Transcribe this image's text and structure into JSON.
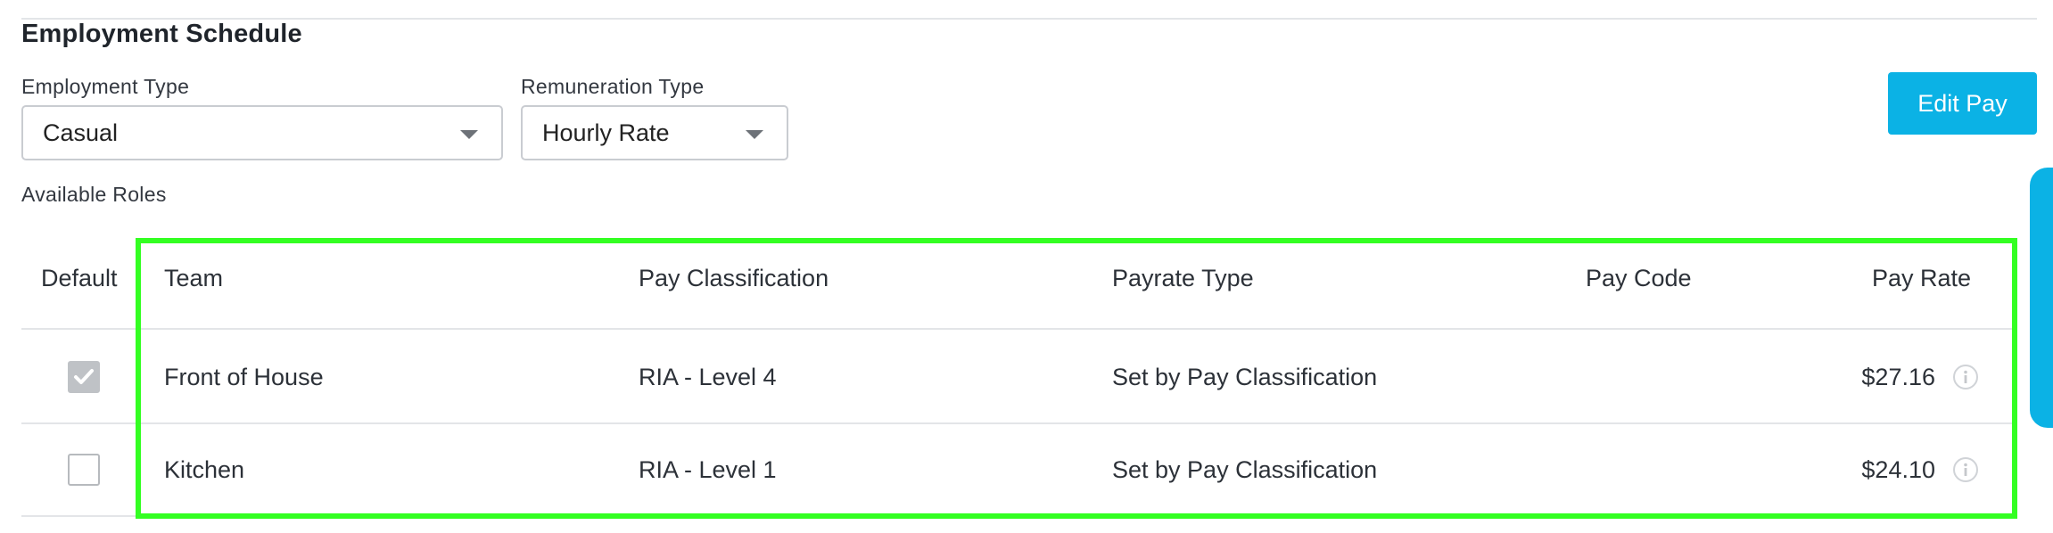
{
  "section": {
    "title": "Employment Schedule"
  },
  "filters": {
    "employment_type": {
      "label": "Employment Type",
      "value": "Casual"
    },
    "remuneration_type": {
      "label": "Remuneration Type",
      "value": "Hourly Rate"
    }
  },
  "actions": {
    "edit_pay_label": "Edit Pay"
  },
  "roles": {
    "label": "Available Roles",
    "columns": [
      "Default",
      "Team",
      "Pay Classification",
      "Payrate Type",
      "Pay Code",
      "Pay Rate"
    ],
    "rows": [
      {
        "default": true,
        "team": "Front of House",
        "pay_classification": "RIA - Level 4",
        "payrate_type": "Set by Pay Classification",
        "pay_code": "",
        "pay_rate": "$27.16"
      },
      {
        "default": false,
        "team": "Kitchen",
        "pay_classification": "RIA - Level 1",
        "payrate_type": "Set by Pay Classification",
        "pay_code": "",
        "pay_rate": "$24.10"
      }
    ]
  },
  "colors": {
    "accent": "#0bb2e5",
    "highlight": "#33ff22",
    "checkbox_checked": "#bfc2c6"
  },
  "icons": [
    "chevron-down-icon",
    "checkmark-icon",
    "info-icon"
  ]
}
